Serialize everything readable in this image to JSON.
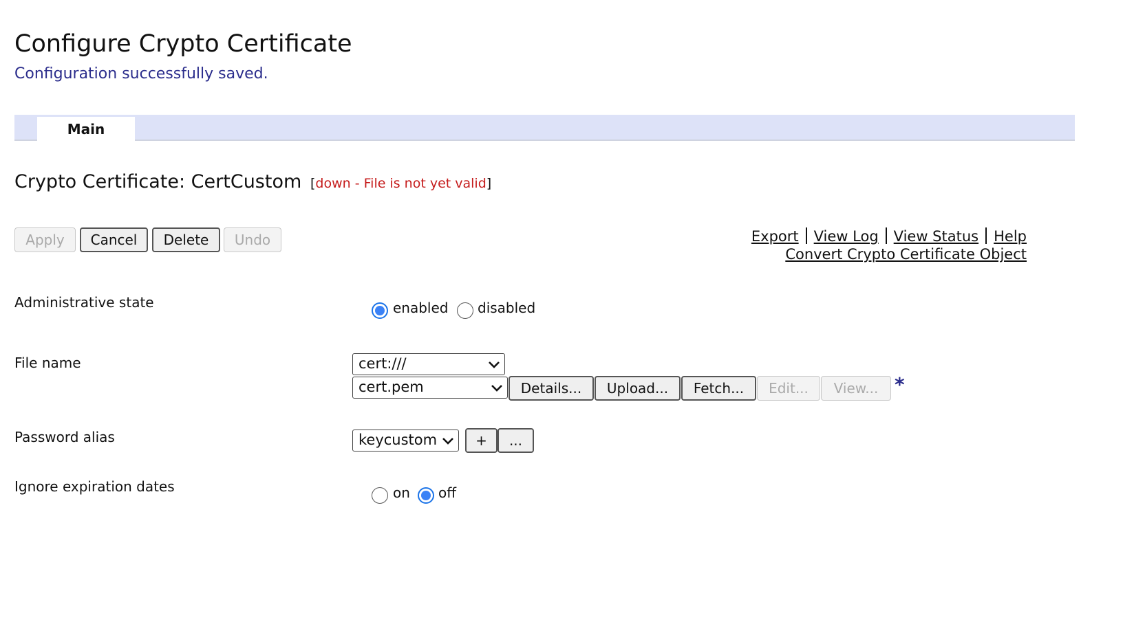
{
  "page": {
    "title": "Configure Crypto Certificate",
    "message": "Configuration successfully saved."
  },
  "tabs": [
    {
      "label": "Main",
      "active": true
    }
  ],
  "object": {
    "heading": "Crypto Certificate: CertCustom",
    "status_open": "[",
    "status_text": "down - File is not yet valid",
    "status_close": "]"
  },
  "actions": {
    "apply": "Apply",
    "cancel": "Cancel",
    "delete": "Delete",
    "undo": "Undo"
  },
  "links": {
    "export": "Export",
    "view_log": "View Log",
    "view_status": "View Status",
    "help": "Help",
    "convert": "Convert Crypto Certificate Object"
  },
  "fields": {
    "admin_state": {
      "label": "Administrative state",
      "options": [
        "enabled",
        "disabled"
      ],
      "selected": "enabled"
    },
    "file_name": {
      "label": "File name",
      "directory": "cert:///",
      "file": "cert.pem",
      "buttons": {
        "details": "Details...",
        "upload": "Upload...",
        "fetch": "Fetch...",
        "edit": "Edit...",
        "view": "View..."
      },
      "required_marker": "*"
    },
    "password_alias": {
      "label": "Password alias",
      "value": "keycustom",
      "add": "+",
      "more": "..."
    },
    "ignore_expiration": {
      "label": "Ignore expiration dates",
      "options": [
        "on",
        "off"
      ],
      "selected": "off"
    }
  },
  "colors": {
    "tab_bar": "#dde2f8",
    "message": "#2b2d8c",
    "status_error": "#c51b1b",
    "radio_checked": "#3b82f6"
  }
}
